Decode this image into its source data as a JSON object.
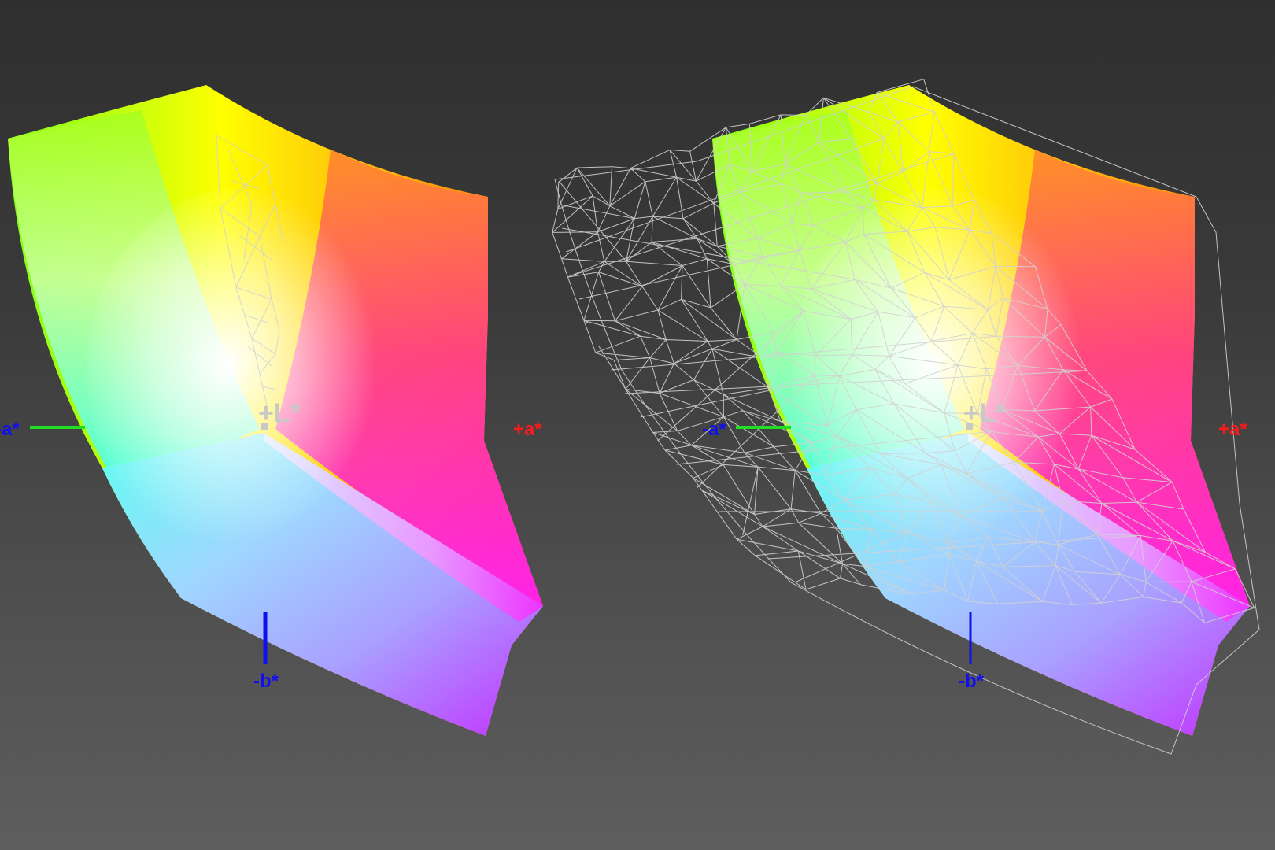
{
  "views": [
    {
      "id": "left",
      "labels": {
        "neg_a": "-a*",
        "pos_a": "+a*",
        "pos_l": "+L*",
        "neg_b": "-b*"
      },
      "wireframe_overlay": "partial"
    },
    {
      "id": "right",
      "labels": {
        "neg_a": "-a*",
        "pos_a": "+a*",
        "pos_l": "+L*",
        "neg_b": "-b*"
      },
      "wireframe_overlay": "full"
    }
  ],
  "colors": {
    "background_top": "#2f2f2f",
    "background_bottom": "#5e5e5e",
    "pos_a_label": "#ff1a1a",
    "neg_a_axis": "#22dd22",
    "b_axis": "#1010ee",
    "l_label": "#c8c8c8",
    "wireframe": "#d2d2d2"
  }
}
